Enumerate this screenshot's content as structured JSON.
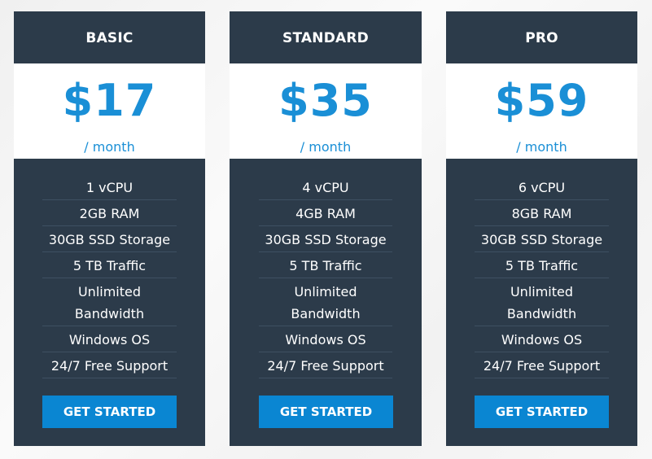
{
  "plans": [
    {
      "name": "BASIC",
      "price": "$17",
      "period": "/ month",
      "features": [
        "1 vCPU",
        "2GB RAM",
        "30GB SSD Storage",
        "5 TB Traffic",
        "Unlimited Bandwidth",
        "Windows OS",
        "24/7 Free Support"
      ],
      "cta": "GET STARTED"
    },
    {
      "name": "STANDARD",
      "price": "$35",
      "period": "/ month",
      "features": [
        "4 vCPU",
        "4GB RAM",
        "30GB SSD Storage",
        "5 TB Traffic",
        "Unlimited Bandwidth",
        "Windows OS",
        "24/7 Free Support"
      ],
      "cta": "GET STARTED"
    },
    {
      "name": "PRO",
      "price": "$59",
      "period": "/ month",
      "features": [
        "6 vCPU",
        "8GB RAM",
        "30GB SSD Storage",
        "5 TB Traffic",
        "Unlimited Bandwidth",
        "Windows OS",
        "24/7 Free Support"
      ],
      "cta": "GET STARTED"
    }
  ],
  "colors": {
    "card_bg": "#2c3b4a",
    "accent": "#1a8fd6",
    "button": "#0a86d2"
  }
}
